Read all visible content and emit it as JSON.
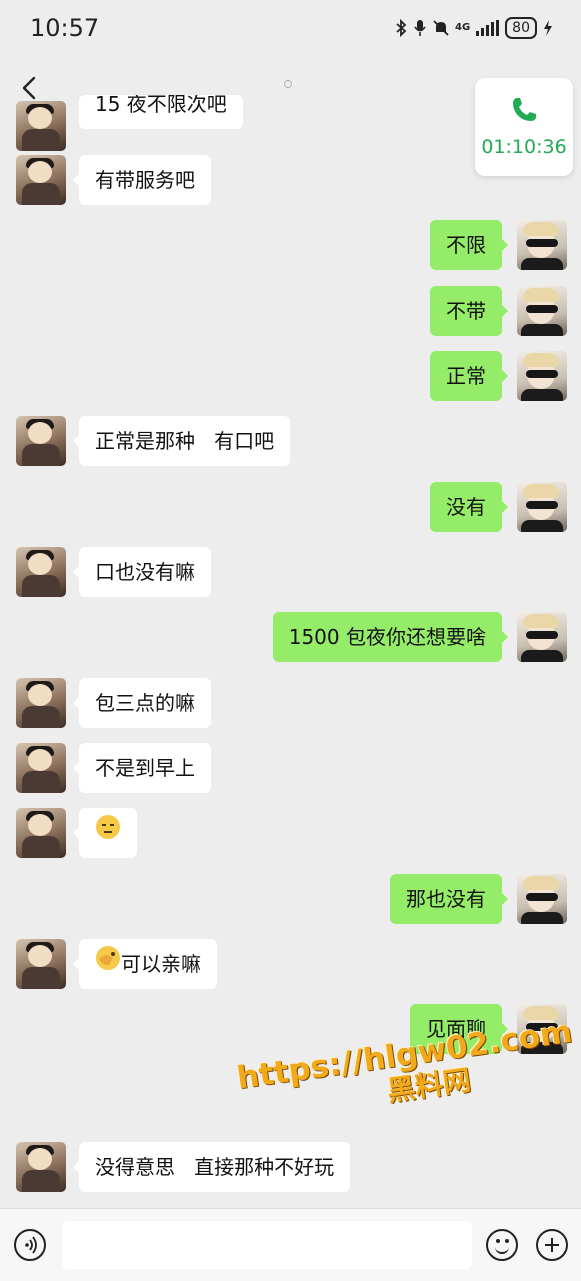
{
  "status_bar": {
    "time": "10:57",
    "network": "4G",
    "battery": "80"
  },
  "call": {
    "duration": "01:10:36",
    "accent_color": "#22aa55"
  },
  "colors": {
    "sent_bubble": "#95ec69",
    "received_bubble": "#ffffff",
    "background": "#ededed"
  },
  "messages": [
    {
      "side": "left",
      "text": "15 夜不限次吧",
      "partial": true
    },
    {
      "side": "left",
      "text": "有带服务吧"
    },
    {
      "side": "right",
      "text": "不限"
    },
    {
      "side": "right",
      "text": "不带"
    },
    {
      "side": "right",
      "text": "正常"
    },
    {
      "side": "left",
      "text": "正常是那种   有口吧"
    },
    {
      "side": "right",
      "text": "没有"
    },
    {
      "side": "left",
      "text": "口也没有嘛"
    },
    {
      "side": "right",
      "text": "1500 包夜你还想要啥"
    },
    {
      "side": "left",
      "text": "包三点的嘛"
    },
    {
      "side": "left",
      "text": "不是到早上"
    },
    {
      "side": "left",
      "text": "",
      "emoji": "speechless-face-emoji"
    },
    {
      "side": "right",
      "text": "那也没有"
    },
    {
      "side": "left",
      "text": "可以亲嘛",
      "emoji": "facepalm-emoji"
    },
    {
      "side": "right",
      "text": "见面聊"
    },
    {
      "side": "left",
      "text": "没得意思   直接那种不好玩"
    }
  ],
  "watermark": {
    "url": "https://hlgw02.com",
    "label": "黑料网"
  },
  "input": {
    "placeholder": ""
  }
}
